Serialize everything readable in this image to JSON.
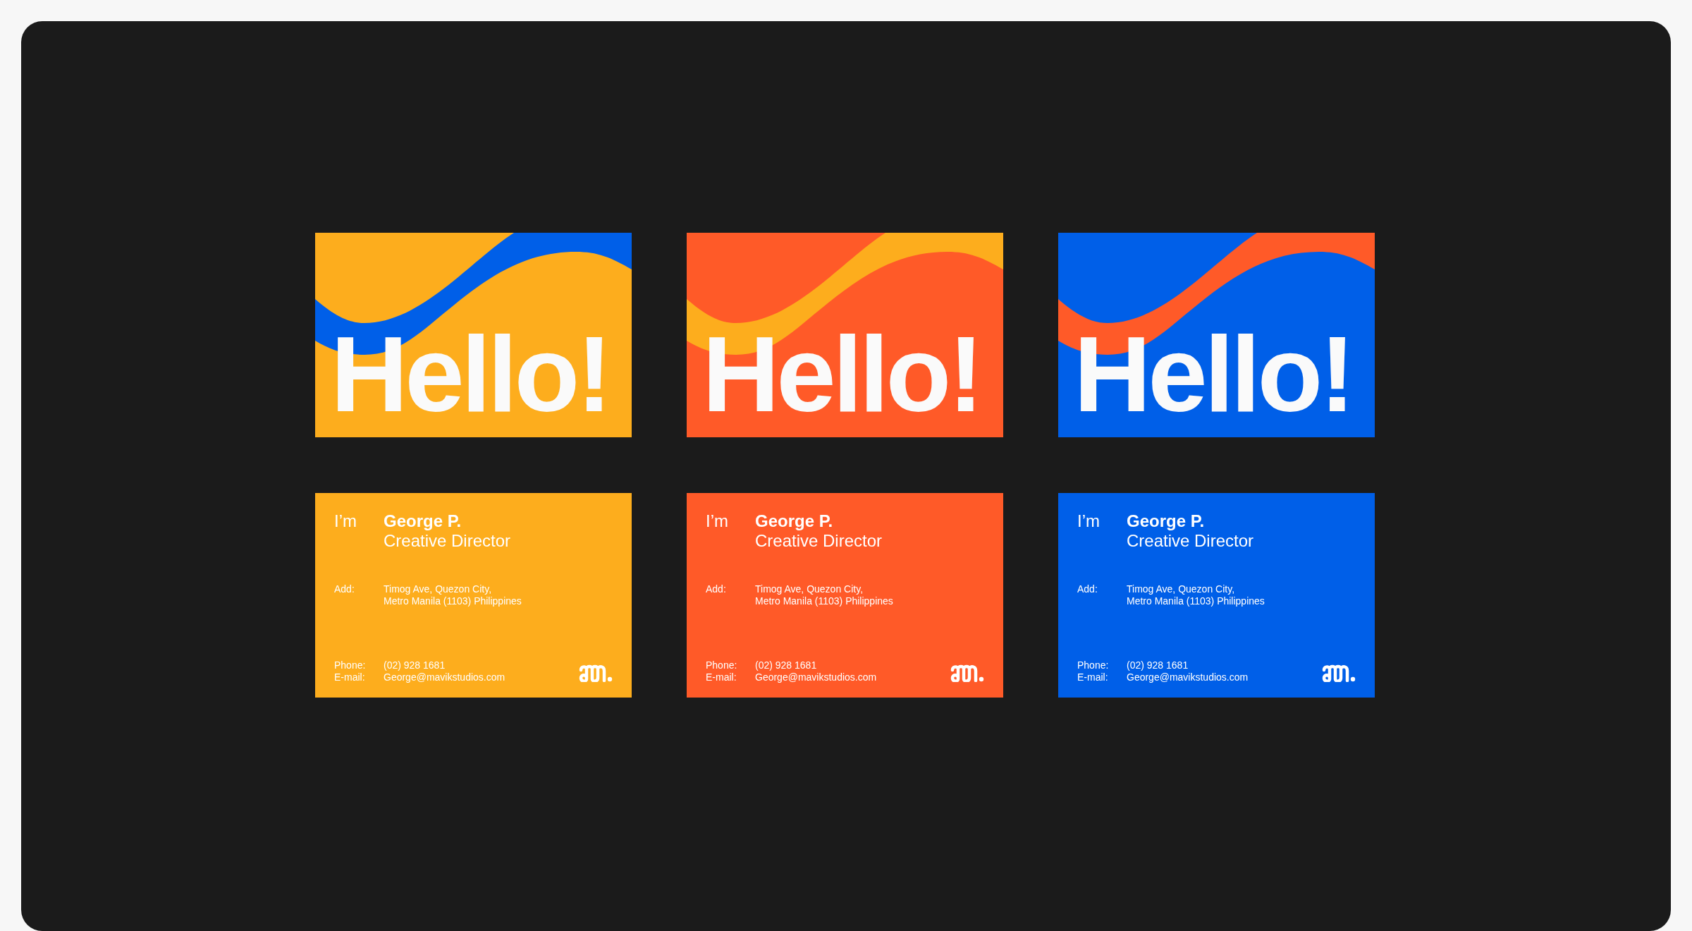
{
  "fronts": [
    {
      "title": "Hello!",
      "color": "#fdad1d",
      "wave": {
        "color": "#005fe8"
      }
    },
    {
      "title": "Hello!",
      "color": "#ff5a28",
      "wave": {
        "color": "#fdad1d"
      }
    },
    {
      "title": "Hello!",
      "color": "#005fe8",
      "wave": {
        "color": "#ff5a28"
      }
    }
  ],
  "backs": [
    {
      "color": "#fdad1d",
      "greeting": "I’m",
      "name": "George P.",
      "role": "Creative Director",
      "address_label": "Add:",
      "address": [
        "Timog Ave, Quezon City,",
        "Metro Manila (1103) Philippines"
      ],
      "phone_label": "Phone:",
      "phone": "(02) 928 1681",
      "email_label": "E-mail:",
      "email": "George@mavikstudios.com"
    },
    {
      "color": "#ff5a28",
      "greeting": "I’m",
      "name": "George P.",
      "role": "Creative Director",
      "address_label": "Add:",
      "address": [
        "Timog Ave, Quezon City,",
        "Metro Manila (1103) Philippines"
      ],
      "phone_label": "Phone:",
      "phone": "(02) 928 1681",
      "email_label": "E-mail:",
      "email": "George@mavikstudios.com"
    },
    {
      "color": "#005fe8",
      "greeting": "I’m",
      "name": "George P.",
      "role": "Creative Director",
      "address_label": "Add:",
      "address": [
        "Timog Ave, Quezon City,",
        "Metro Manila (1103) Philippines"
      ],
      "phone_label": "Phone:",
      "phone": "(02) 928 1681",
      "email_label": "E-mail:",
      "email": "George@mavikstudios.com"
    }
  ]
}
